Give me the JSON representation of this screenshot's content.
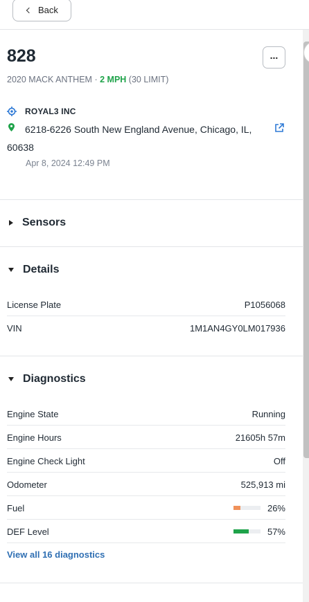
{
  "nav": {
    "back_label": "Back"
  },
  "vehicle": {
    "name": "828",
    "model": "2020 MACK ANTHEM",
    "separator": "·",
    "speed": "2 MPH",
    "limit": "(30 LIMIT)",
    "company": "ROYAL3 INC",
    "address": "6218-6226 South New England Avenue, Chicago, IL, 60638",
    "timestamp": "Apr 8, 2024 12:49 PM"
  },
  "sections": {
    "sensors": {
      "title": "Sensors"
    },
    "details": {
      "title": "Details",
      "rows": [
        {
          "label": "License Plate",
          "value": "P1056068"
        },
        {
          "label": "VIN",
          "value": "1M1AN4GY0LM017936"
        }
      ]
    },
    "diagnostics": {
      "title": "Diagnostics",
      "rows": [
        {
          "label": "Engine State",
          "value": "Running"
        },
        {
          "label": "Engine Hours",
          "value": "21605h 57m"
        },
        {
          "label": "Engine Check Light",
          "value": "Off"
        },
        {
          "label": "Odometer",
          "value": "525,913 mi"
        }
      ],
      "fuel": {
        "label": "Fuel",
        "value": "26%",
        "level": 0.26,
        "color": "#f0915a"
      },
      "def": {
        "label": "DEF Level",
        "value": "57%",
        "level": 0.57,
        "color": "#1fa34a"
      },
      "view_all": "View all 16 diagnostics"
    }
  },
  "icons": {
    "back": "chevron-left-icon",
    "more": "more-horizontal-icon",
    "company": "crosshair-icon",
    "location": "map-pin-icon",
    "external": "external-link-icon",
    "collapsed": "caret-right-icon",
    "expanded": "caret-down-icon"
  },
  "colors": {
    "speed": "#1fa34a",
    "link": "#2f6fb3",
    "icon_blue": "#2f7ad6",
    "pin_green": "#1fa34a"
  }
}
